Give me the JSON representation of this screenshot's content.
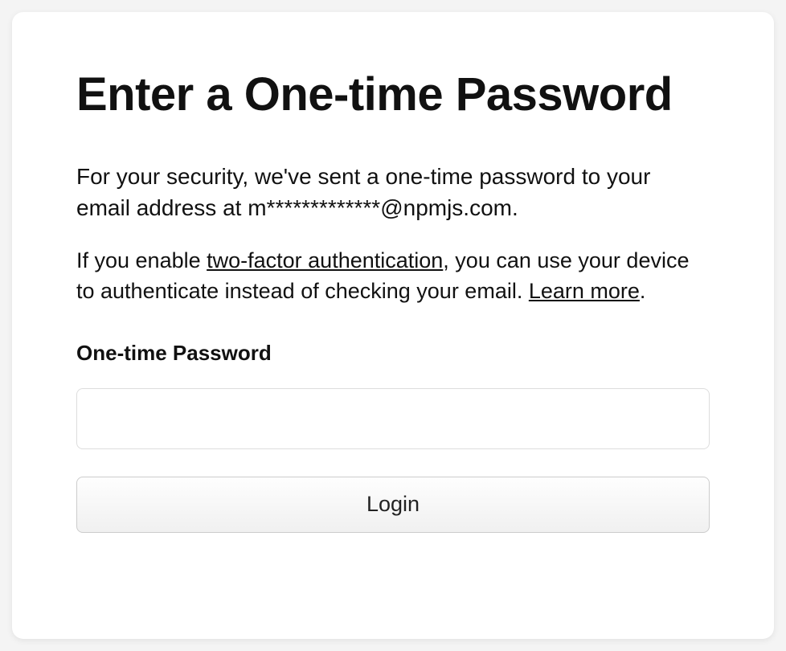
{
  "title": "Enter a One-time Password",
  "intro": {
    "prefix": "For your security, we've sent a one-time password to your email address at ",
    "masked_email": "m*************@npmjs.com",
    "suffix": "."
  },
  "intro2": {
    "part1": "If you enable ",
    "link1": "two-factor authentication",
    "part2": ", you can use your device to authenticate instead of checking your email. ",
    "link2": "Learn more",
    "part3": "."
  },
  "field": {
    "label": "One-time Password",
    "value": ""
  },
  "button": {
    "login": "Login"
  }
}
